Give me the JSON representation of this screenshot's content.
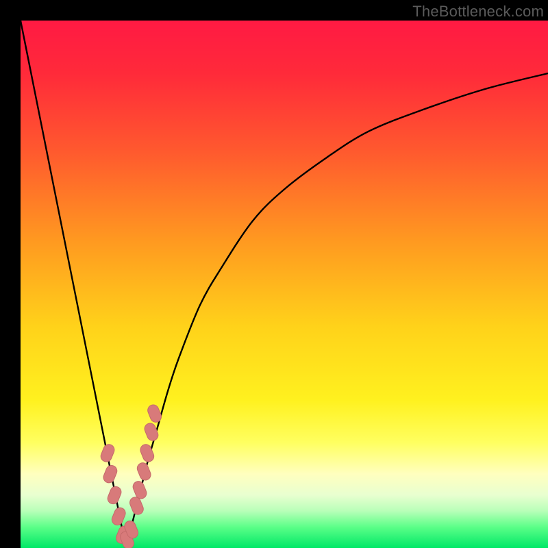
{
  "watermark": "TheBottleneck.com",
  "colors": {
    "frame": "#000000",
    "curve": "#000000",
    "marker_fill": "#d87a7a",
    "marker_stroke": "#c46a6a",
    "gradient_stops": [
      {
        "offset": 0.0,
        "color": "#ff1a43"
      },
      {
        "offset": 0.1,
        "color": "#ff2a3a"
      },
      {
        "offset": 0.25,
        "color": "#ff5a2e"
      },
      {
        "offset": 0.42,
        "color": "#ff9a20"
      },
      {
        "offset": 0.58,
        "color": "#ffd21a"
      },
      {
        "offset": 0.72,
        "color": "#fff11f"
      },
      {
        "offset": 0.8,
        "color": "#ffff60"
      },
      {
        "offset": 0.86,
        "color": "#ffffbf"
      },
      {
        "offset": 0.9,
        "color": "#e8ffd0"
      },
      {
        "offset": 0.93,
        "color": "#b8ffb8"
      },
      {
        "offset": 0.96,
        "color": "#5cff88"
      },
      {
        "offset": 1.0,
        "color": "#00e867"
      }
    ]
  },
  "chart_data": {
    "type": "line",
    "title": "",
    "xlabel": "",
    "ylabel": "",
    "xlim": [
      0,
      100
    ],
    "ylim": [
      0,
      100
    ],
    "optimum_x": 20,
    "series": [
      {
        "name": "bottleneck-curve",
        "x": [
          0,
          2,
          4,
          6,
          8,
          10,
          12,
          14,
          16,
          17,
          18,
          19,
          20,
          21,
          22,
          23,
          24,
          26,
          28,
          30,
          34,
          38,
          44,
          50,
          58,
          66,
          76,
          88,
          100
        ],
        "y": [
          100,
          90,
          80,
          70,
          60,
          50,
          40,
          30,
          20,
          15,
          10,
          5,
          0,
          4,
          8,
          12,
          16,
          23,
          30,
          36,
          46,
          53,
          62,
          68,
          74,
          79,
          83,
          87,
          90
        ]
      }
    ],
    "markers": {
      "name": "highlighted-points",
      "x": [
        16.5,
        17.0,
        17.8,
        18.6,
        19.4,
        20.2,
        21.0,
        22.0,
        22.6,
        23.4,
        24.0,
        24.8,
        25.4
      ],
      "y": [
        18.0,
        14.0,
        10.0,
        6.0,
        2.5,
        1.5,
        3.5,
        8.0,
        11.0,
        14.5,
        18.0,
        22.0,
        25.5
      ]
    }
  }
}
